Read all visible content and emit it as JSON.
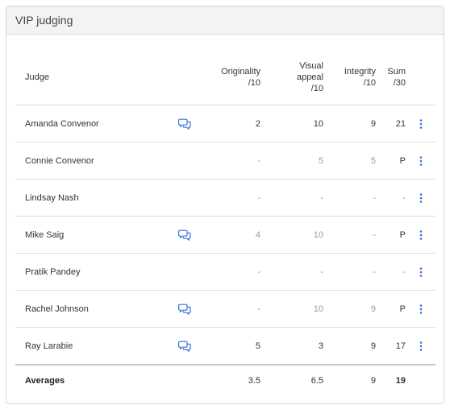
{
  "panel": {
    "title": "VIP judging"
  },
  "colors": {
    "accent": "#3a6fd8",
    "muted": "#9a9a9a",
    "text": "#333333"
  },
  "columns": {
    "judge": "Judge",
    "originality": [
      "Originality",
      "/10"
    ],
    "visual": [
      "Visual",
      "appeal",
      "/10"
    ],
    "integrity": [
      "Integrity",
      "/10"
    ],
    "sum": [
      "Sum",
      "/30"
    ]
  },
  "rows": [
    {
      "judge": "Amanda Convenor",
      "comment": true,
      "originality": "2",
      "visual": "10",
      "integrity": "9",
      "sum": "21",
      "muted": [
        false,
        false,
        false,
        false
      ]
    },
    {
      "judge": "Connie Convenor",
      "comment": false,
      "originality": "-",
      "visual": "5",
      "integrity": "5",
      "sum": "P",
      "muted": [
        true,
        true,
        true,
        false
      ]
    },
    {
      "judge": "Lindsay Nash",
      "comment": false,
      "originality": "-",
      "visual": "-",
      "integrity": "-",
      "sum": "-",
      "muted": [
        true,
        true,
        true,
        true
      ]
    },
    {
      "judge": "Mike Saig",
      "comment": true,
      "originality": "4",
      "visual": "10",
      "integrity": "-",
      "sum": "P",
      "muted": [
        true,
        true,
        true,
        false
      ]
    },
    {
      "judge": "Pratik Pandey",
      "comment": false,
      "originality": "-",
      "visual": "-",
      "integrity": "-",
      "sum": "-",
      "muted": [
        true,
        true,
        true,
        true
      ]
    },
    {
      "judge": "Rachel Johnson",
      "comment": true,
      "originality": "-",
      "visual": "10",
      "integrity": "9",
      "sum": "P",
      "muted": [
        true,
        true,
        true,
        false
      ]
    },
    {
      "judge": "Ray Larabie",
      "comment": true,
      "originality": "5",
      "visual": "3",
      "integrity": "9",
      "sum": "17",
      "muted": [
        false,
        false,
        false,
        false
      ]
    }
  ],
  "averages": {
    "label": "Averages",
    "originality": "3.5",
    "visual": "6.5",
    "integrity": "9",
    "sum": "19"
  },
  "icons": {
    "comment": "chat-bubbles-icon",
    "menu": "kebab-menu-icon"
  }
}
